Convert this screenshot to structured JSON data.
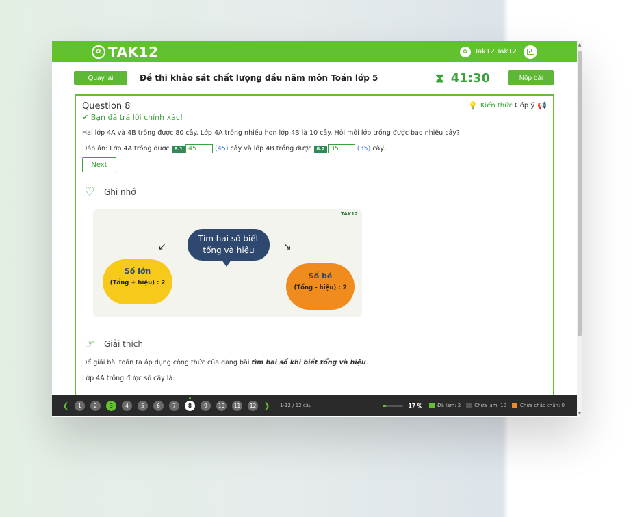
{
  "header": {
    "logo_text": "TAK12",
    "user_name": "Tak12 Tak12",
    "brand_color": "#62c12f"
  },
  "subbar": {
    "back_label": "Quay lại",
    "exam_title": "Đề thi khảo sát chất lượng đầu năm môn Toán lớp 5",
    "timer": "41:30",
    "submit_label": "Nộp bài"
  },
  "question": {
    "title": "Question 8",
    "knowledge_link": "Kiến thức",
    "feedback_link": "Góp ý",
    "status": "Bạn đã trả lời chính xác!",
    "text": "Hai lớp 4A và 4B trồng được 80 cây. Lớp 4A trồng nhiều hơn lớp 4B là 10 cây. Hỏi mỗi lớp trồng được bao nhiêu cây?",
    "answer_prefix": "Đáp án: Lớp 4A trồng được",
    "tag1": "8.1",
    "value1": "45",
    "correct1": "(45)",
    "answer_middle": "cây và lớp 4B trồng được",
    "tag2": "8.2",
    "value2": "35",
    "correct2": "(35)",
    "answer_suffix": "cây.",
    "next_label": "Next"
  },
  "memo": {
    "heading": "Ghi nhớ",
    "brand": "TAK12",
    "bubble_line1": "Tìm hai số biết",
    "bubble_line2": "tổng và hiệu",
    "big_title": "Số lớn",
    "big_formula": "(Tổng + hiệu) : 2",
    "small_title": "Số bé",
    "small_formula": "(Tổng - hiệu) : 2"
  },
  "explanation": {
    "heading": "Giải thích",
    "line1_prefix": "Để giải bài toán ta áp dụng công thức của dạng bài",
    "line1_emphasis": "tìm hai số khi biết tổng và hiệu",
    "line1_suffix": ".",
    "line2": "Lớp 4A trồng được số cây là:"
  },
  "navigation": {
    "questions": [
      {
        "num": "1",
        "state": "pending"
      },
      {
        "num": "2",
        "state": "pending"
      },
      {
        "num": "3",
        "state": "done"
      },
      {
        "num": "4",
        "state": "pending"
      },
      {
        "num": "5",
        "state": "pending"
      },
      {
        "num": "6",
        "state": "pending"
      },
      {
        "num": "7",
        "state": "pending"
      },
      {
        "num": "8",
        "state": "current"
      },
      {
        "num": "9",
        "state": "pending"
      },
      {
        "num": "10",
        "state": "pending"
      },
      {
        "num": "11",
        "state": "pending"
      },
      {
        "num": "12",
        "state": "pending"
      }
    ],
    "page_info": "1-12 / 12 câu",
    "progress_percent": 17,
    "progress_label": "17 %",
    "done_label": "Đã làm: 2",
    "todo_label": "Chưa làm: 10",
    "unsure_label": "Chưa chắc chắn: 0",
    "done_color": "#62c12f",
    "todo_color": "#555555",
    "unsure_color": "#f08a24"
  }
}
